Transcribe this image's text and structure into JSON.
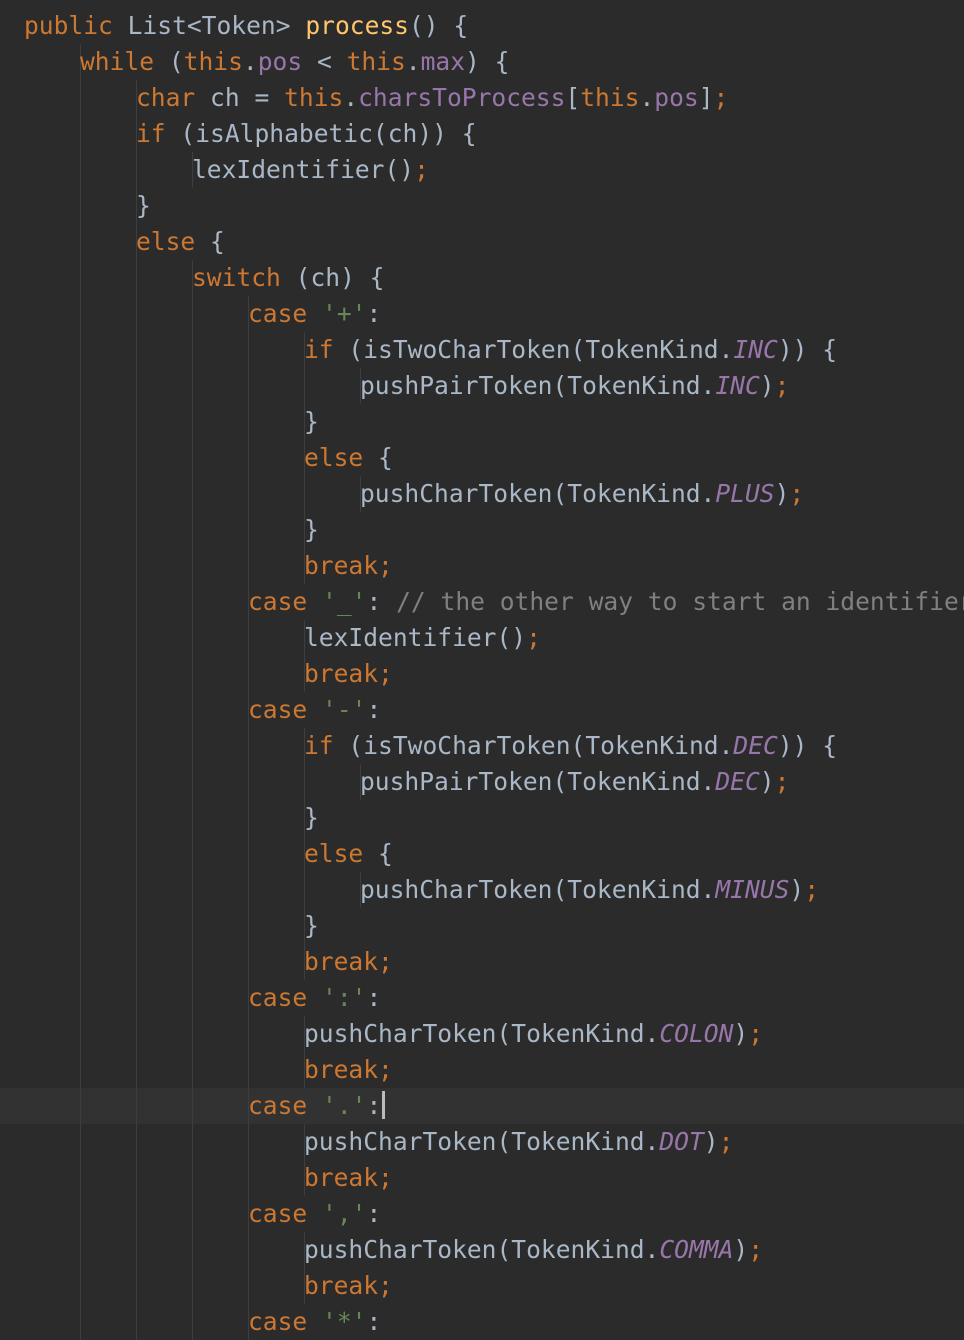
{
  "editor": {
    "language": "java",
    "caret_line": 30,
    "colors": {
      "background": "#2b2b2b",
      "current_line": "#323232",
      "keyword": "#cc7832",
      "method": "#ffc66d",
      "field": "#9876aa",
      "string": "#6a8759",
      "comment": "#808080",
      "plain": "#a9b7c6"
    },
    "lines": [
      {
        "indent": 0,
        "tokens": [
          {
            "t": "public",
            "c": "kw"
          },
          {
            "t": " List<Token> ",
            "c": "pl"
          },
          {
            "t": "process",
            "c": "fn"
          },
          {
            "t": "() {",
            "c": "pl"
          }
        ]
      },
      {
        "indent": 1,
        "tokens": [
          {
            "t": "while",
            "c": "kw"
          },
          {
            "t": " (",
            "c": "pl"
          },
          {
            "t": "this",
            "c": "kw"
          },
          {
            "t": ".",
            "c": "pl"
          },
          {
            "t": "pos",
            "c": "fld"
          },
          {
            "t": " < ",
            "c": "pl"
          },
          {
            "t": "this",
            "c": "kw"
          },
          {
            "t": ".",
            "c": "pl"
          },
          {
            "t": "max",
            "c": "fld"
          },
          {
            "t": ") {",
            "c": "pl"
          }
        ]
      },
      {
        "indent": 2,
        "tokens": [
          {
            "t": "char",
            "c": "kw"
          },
          {
            "t": " ch = ",
            "c": "pl"
          },
          {
            "t": "this",
            "c": "kw"
          },
          {
            "t": ".",
            "c": "pl"
          },
          {
            "t": "charsToProcess",
            "c": "fld"
          },
          {
            "t": "[",
            "c": "pl"
          },
          {
            "t": "this",
            "c": "kw"
          },
          {
            "t": ".",
            "c": "pl"
          },
          {
            "t": "pos",
            "c": "fld"
          },
          {
            "t": "]",
            "c": "pl"
          },
          {
            "t": ";",
            "c": "kw"
          }
        ]
      },
      {
        "indent": 2,
        "tokens": [
          {
            "t": "if",
            "c": "kw"
          },
          {
            "t": " (isAlphabetic(ch)) {",
            "c": "pl"
          }
        ]
      },
      {
        "indent": 3,
        "tokens": [
          {
            "t": "lexIdentifier()",
            "c": "pl"
          },
          {
            "t": ";",
            "c": "kw"
          }
        ]
      },
      {
        "indent": 2,
        "tokens": [
          {
            "t": "}",
            "c": "pl"
          }
        ]
      },
      {
        "indent": 2,
        "tokens": [
          {
            "t": "else",
            "c": "kw"
          },
          {
            "t": " {",
            "c": "pl"
          }
        ]
      },
      {
        "indent": 3,
        "tokens": [
          {
            "t": "switch",
            "c": "kw"
          },
          {
            "t": " (ch) {",
            "c": "pl"
          }
        ]
      },
      {
        "indent": 4,
        "tokens": [
          {
            "t": "case",
            "c": "kw"
          },
          {
            "t": " ",
            "c": "pl"
          },
          {
            "t": "'+'",
            "c": "str"
          },
          {
            "t": ":",
            "c": "pl"
          }
        ]
      },
      {
        "indent": 5,
        "tokens": [
          {
            "t": "if",
            "c": "kw"
          },
          {
            "t": " (isTwoCharToken(TokenKind.",
            "c": "pl"
          },
          {
            "t": "INC",
            "c": "cst"
          },
          {
            "t": ")) {",
            "c": "pl"
          }
        ]
      },
      {
        "indent": 6,
        "tokens": [
          {
            "t": "pushPairToken(TokenKind.",
            "c": "pl"
          },
          {
            "t": "INC",
            "c": "cst"
          },
          {
            "t": ")",
            "c": "pl"
          },
          {
            "t": ";",
            "c": "kw"
          }
        ]
      },
      {
        "indent": 5,
        "tokens": [
          {
            "t": "}",
            "c": "pl"
          }
        ]
      },
      {
        "indent": 5,
        "tokens": [
          {
            "t": "else",
            "c": "kw"
          },
          {
            "t": " {",
            "c": "pl"
          }
        ]
      },
      {
        "indent": 6,
        "tokens": [
          {
            "t": "pushCharToken(TokenKind.",
            "c": "pl"
          },
          {
            "t": "PLUS",
            "c": "cst"
          },
          {
            "t": ")",
            "c": "pl"
          },
          {
            "t": ";",
            "c": "kw"
          }
        ]
      },
      {
        "indent": 5,
        "tokens": [
          {
            "t": "}",
            "c": "pl"
          }
        ]
      },
      {
        "indent": 5,
        "tokens": [
          {
            "t": "break;",
            "c": "kw"
          }
        ]
      },
      {
        "indent": 4,
        "tokens": [
          {
            "t": "case",
            "c": "kw"
          },
          {
            "t": " ",
            "c": "pl"
          },
          {
            "t": "'_'",
            "c": "str"
          },
          {
            "t": ": ",
            "c": "pl"
          },
          {
            "t": "// the other way to start an identifier",
            "c": "cmt"
          }
        ]
      },
      {
        "indent": 5,
        "tokens": [
          {
            "t": "lexIdentifier()",
            "c": "pl"
          },
          {
            "t": ";",
            "c": "kw"
          }
        ]
      },
      {
        "indent": 5,
        "tokens": [
          {
            "t": "break;",
            "c": "kw"
          }
        ]
      },
      {
        "indent": 4,
        "tokens": [
          {
            "t": "case",
            "c": "kw"
          },
          {
            "t": " ",
            "c": "pl"
          },
          {
            "t": "'-'",
            "c": "str"
          },
          {
            "t": ":",
            "c": "pl"
          }
        ]
      },
      {
        "indent": 5,
        "tokens": [
          {
            "t": "if",
            "c": "kw"
          },
          {
            "t": " (isTwoCharToken(TokenKind.",
            "c": "pl"
          },
          {
            "t": "DEC",
            "c": "cst"
          },
          {
            "t": ")) {",
            "c": "pl"
          }
        ]
      },
      {
        "indent": 6,
        "tokens": [
          {
            "t": "pushPairToken(TokenKind.",
            "c": "pl"
          },
          {
            "t": "DEC",
            "c": "cst"
          },
          {
            "t": ")",
            "c": "pl"
          },
          {
            "t": ";",
            "c": "kw"
          }
        ]
      },
      {
        "indent": 5,
        "tokens": [
          {
            "t": "}",
            "c": "pl"
          }
        ]
      },
      {
        "indent": 5,
        "tokens": [
          {
            "t": "else",
            "c": "kw"
          },
          {
            "t": " {",
            "c": "pl"
          }
        ]
      },
      {
        "indent": 6,
        "tokens": [
          {
            "t": "pushCharToken(TokenKind.",
            "c": "pl"
          },
          {
            "t": "MINUS",
            "c": "cst"
          },
          {
            "t": ")",
            "c": "pl"
          },
          {
            "t": ";",
            "c": "kw"
          }
        ]
      },
      {
        "indent": 5,
        "tokens": [
          {
            "t": "}",
            "c": "pl"
          }
        ]
      },
      {
        "indent": 5,
        "tokens": [
          {
            "t": "break;",
            "c": "kw"
          }
        ]
      },
      {
        "indent": 4,
        "tokens": [
          {
            "t": "case",
            "c": "kw"
          },
          {
            "t": " ",
            "c": "pl"
          },
          {
            "t": "':'",
            "c": "str"
          },
          {
            "t": ":",
            "c": "pl"
          }
        ]
      },
      {
        "indent": 5,
        "tokens": [
          {
            "t": "pushCharToken(TokenKind.",
            "c": "pl"
          },
          {
            "t": "COLON",
            "c": "cst"
          },
          {
            "t": ")",
            "c": "pl"
          },
          {
            "t": ";",
            "c": "kw"
          }
        ]
      },
      {
        "indent": 5,
        "tokens": [
          {
            "t": "break;",
            "c": "kw"
          }
        ]
      },
      {
        "indent": 4,
        "tokens": [
          {
            "t": "case",
            "c": "kw"
          },
          {
            "t": " ",
            "c": "pl"
          },
          {
            "t": "'.'",
            "c": "str"
          },
          {
            "t": ":",
            "c": "pl"
          }
        ]
      },
      {
        "indent": 5,
        "tokens": [
          {
            "t": "pushCharToken(TokenKind.",
            "c": "pl"
          },
          {
            "t": "DOT",
            "c": "cst"
          },
          {
            "t": ")",
            "c": "pl"
          },
          {
            "t": ";",
            "c": "kw"
          }
        ]
      },
      {
        "indent": 5,
        "tokens": [
          {
            "t": "break;",
            "c": "kw"
          }
        ]
      },
      {
        "indent": 4,
        "tokens": [
          {
            "t": "case",
            "c": "kw"
          },
          {
            "t": " ",
            "c": "pl"
          },
          {
            "t": "','",
            "c": "str"
          },
          {
            "t": ":",
            "c": "pl"
          }
        ]
      },
      {
        "indent": 5,
        "tokens": [
          {
            "t": "pushCharToken(TokenKind.",
            "c": "pl"
          },
          {
            "t": "COMMA",
            "c": "cst"
          },
          {
            "t": ")",
            "c": "pl"
          },
          {
            "t": ";",
            "c": "kw"
          }
        ]
      },
      {
        "indent": 5,
        "tokens": [
          {
            "t": "break;",
            "c": "kw"
          }
        ]
      },
      {
        "indent": 4,
        "tokens": [
          {
            "t": "case",
            "c": "kw"
          },
          {
            "t": " ",
            "c": "pl"
          },
          {
            "t": "'*'",
            "c": "str"
          },
          {
            "t": ":",
            "c": "pl"
          }
        ]
      }
    ]
  }
}
